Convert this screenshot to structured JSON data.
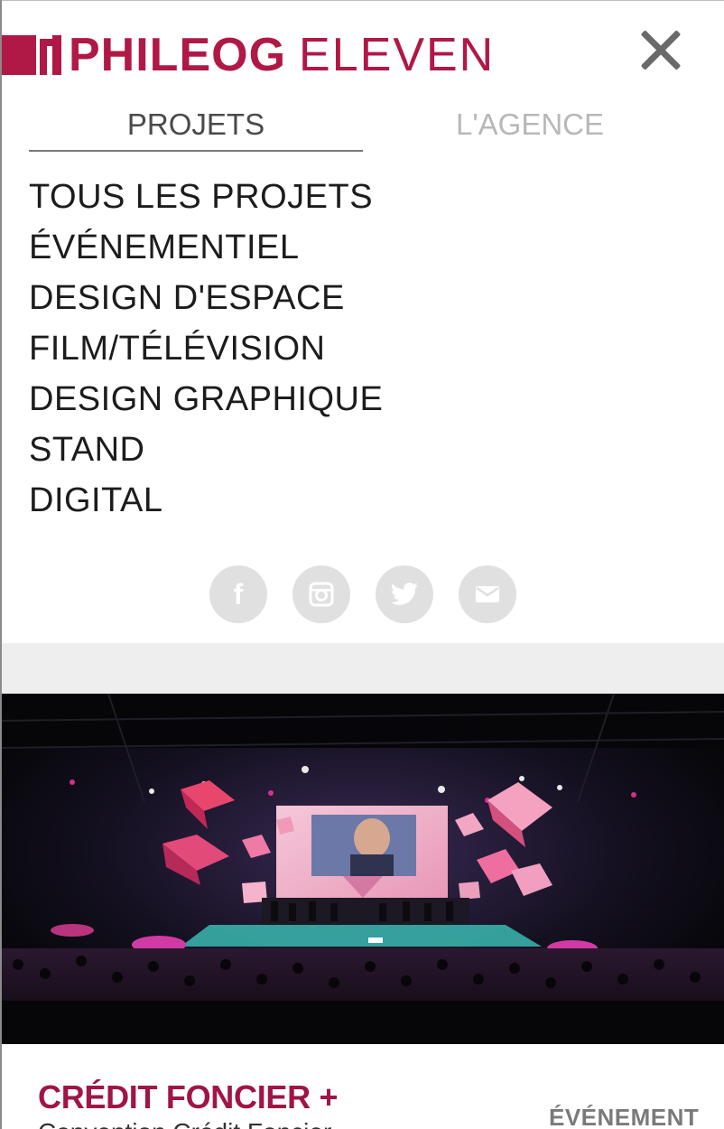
{
  "header": {
    "logo_bold": "PHILEOG",
    "logo_light": "ELEVEN",
    "brand_color": "#b01846",
    "close_icon": "close-icon"
  },
  "tabs": [
    {
      "label": "PROJETS",
      "active": true
    },
    {
      "label": "L'AGENCE",
      "active": false
    }
  ],
  "menu": {
    "items": [
      {
        "label": "TOUS LES PROJETS"
      },
      {
        "label": "ÉVÉNEMENTIEL"
      },
      {
        "label": "DESIGN D'ESPACE"
      },
      {
        "label": "FILM/TÉLÉVISION"
      },
      {
        "label": "DESIGN GRAPHIQUE"
      },
      {
        "label": "STAND"
      },
      {
        "label": "DIGITAL"
      }
    ]
  },
  "social": [
    {
      "icon": "facebook-icon",
      "glyph": "f"
    },
    {
      "icon": "instagram-icon"
    },
    {
      "icon": "twitter-icon"
    },
    {
      "icon": "email-icon"
    }
  ],
  "project_card": {
    "title": "CRÉDIT FONCIER +",
    "subtitle": "Convention Crédit Foncier",
    "category": "ÉVÉNEMENT",
    "title_color": "#a01543"
  }
}
